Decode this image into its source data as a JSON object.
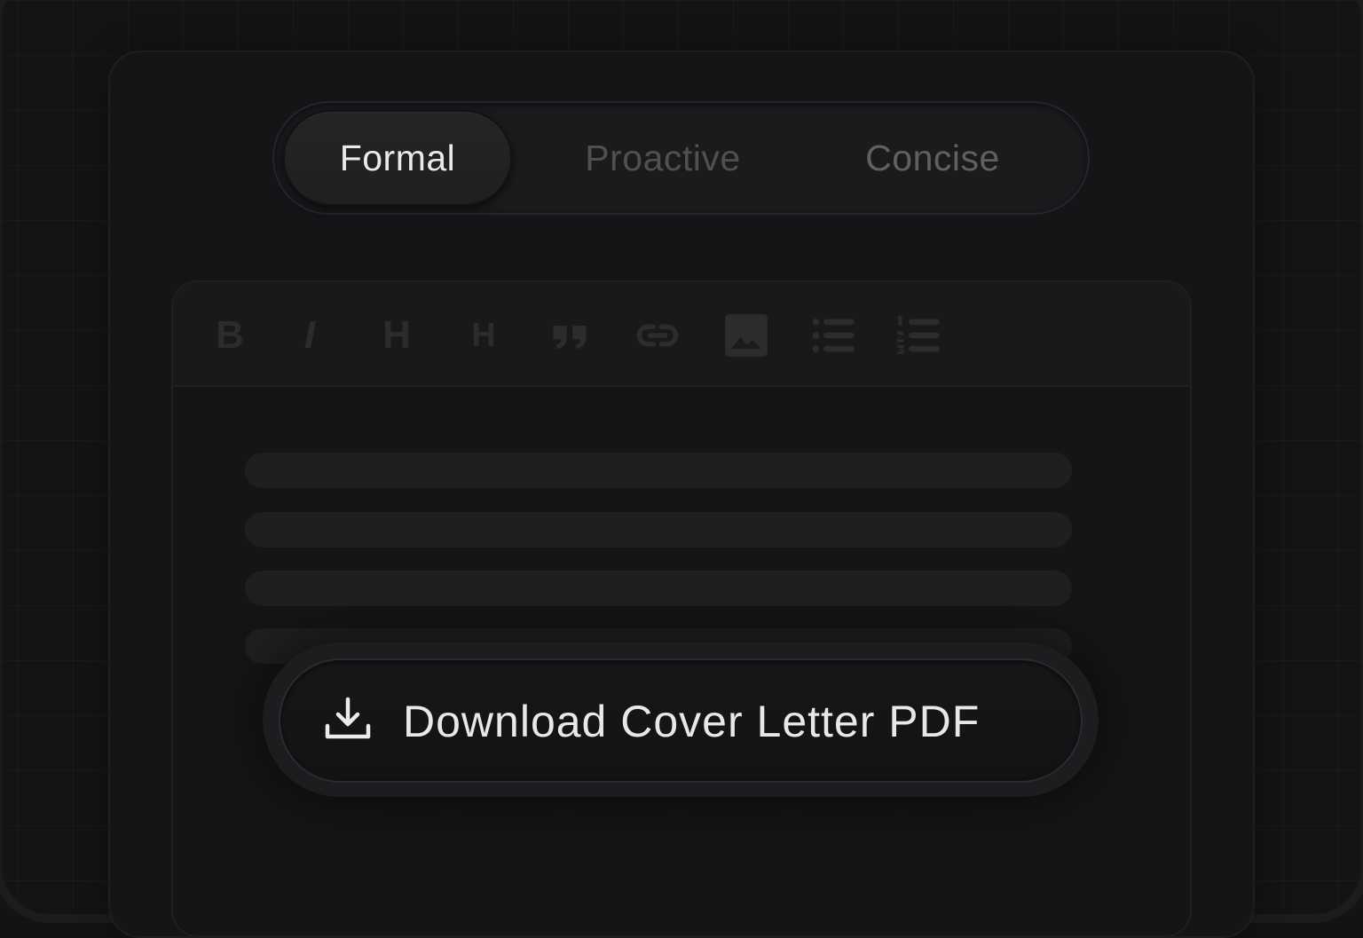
{
  "tones": {
    "options": [
      "Formal",
      "Proactive",
      "Concise"
    ],
    "selected": "Formal"
  },
  "toolbar": {
    "bold_glyph": "B",
    "italic_glyph": "I",
    "heading1_glyph": "H",
    "heading2_glyph": "H",
    "icons": [
      "bold-icon",
      "italic-icon",
      "heading-1-icon",
      "heading-2-icon",
      "quote-icon",
      "link-icon",
      "image-icon",
      "bullet-list-icon",
      "numbered-list-icon"
    ]
  },
  "editor": {
    "placeholder_lines": 4
  },
  "download": {
    "label": "Download Cover Letter PDF",
    "icon": "download-icon"
  },
  "colors": {
    "background": "#131415",
    "active_text": "#e9eaea",
    "inactive_text": "#5e6062",
    "toolbar_icon": "#2b2c2e"
  }
}
